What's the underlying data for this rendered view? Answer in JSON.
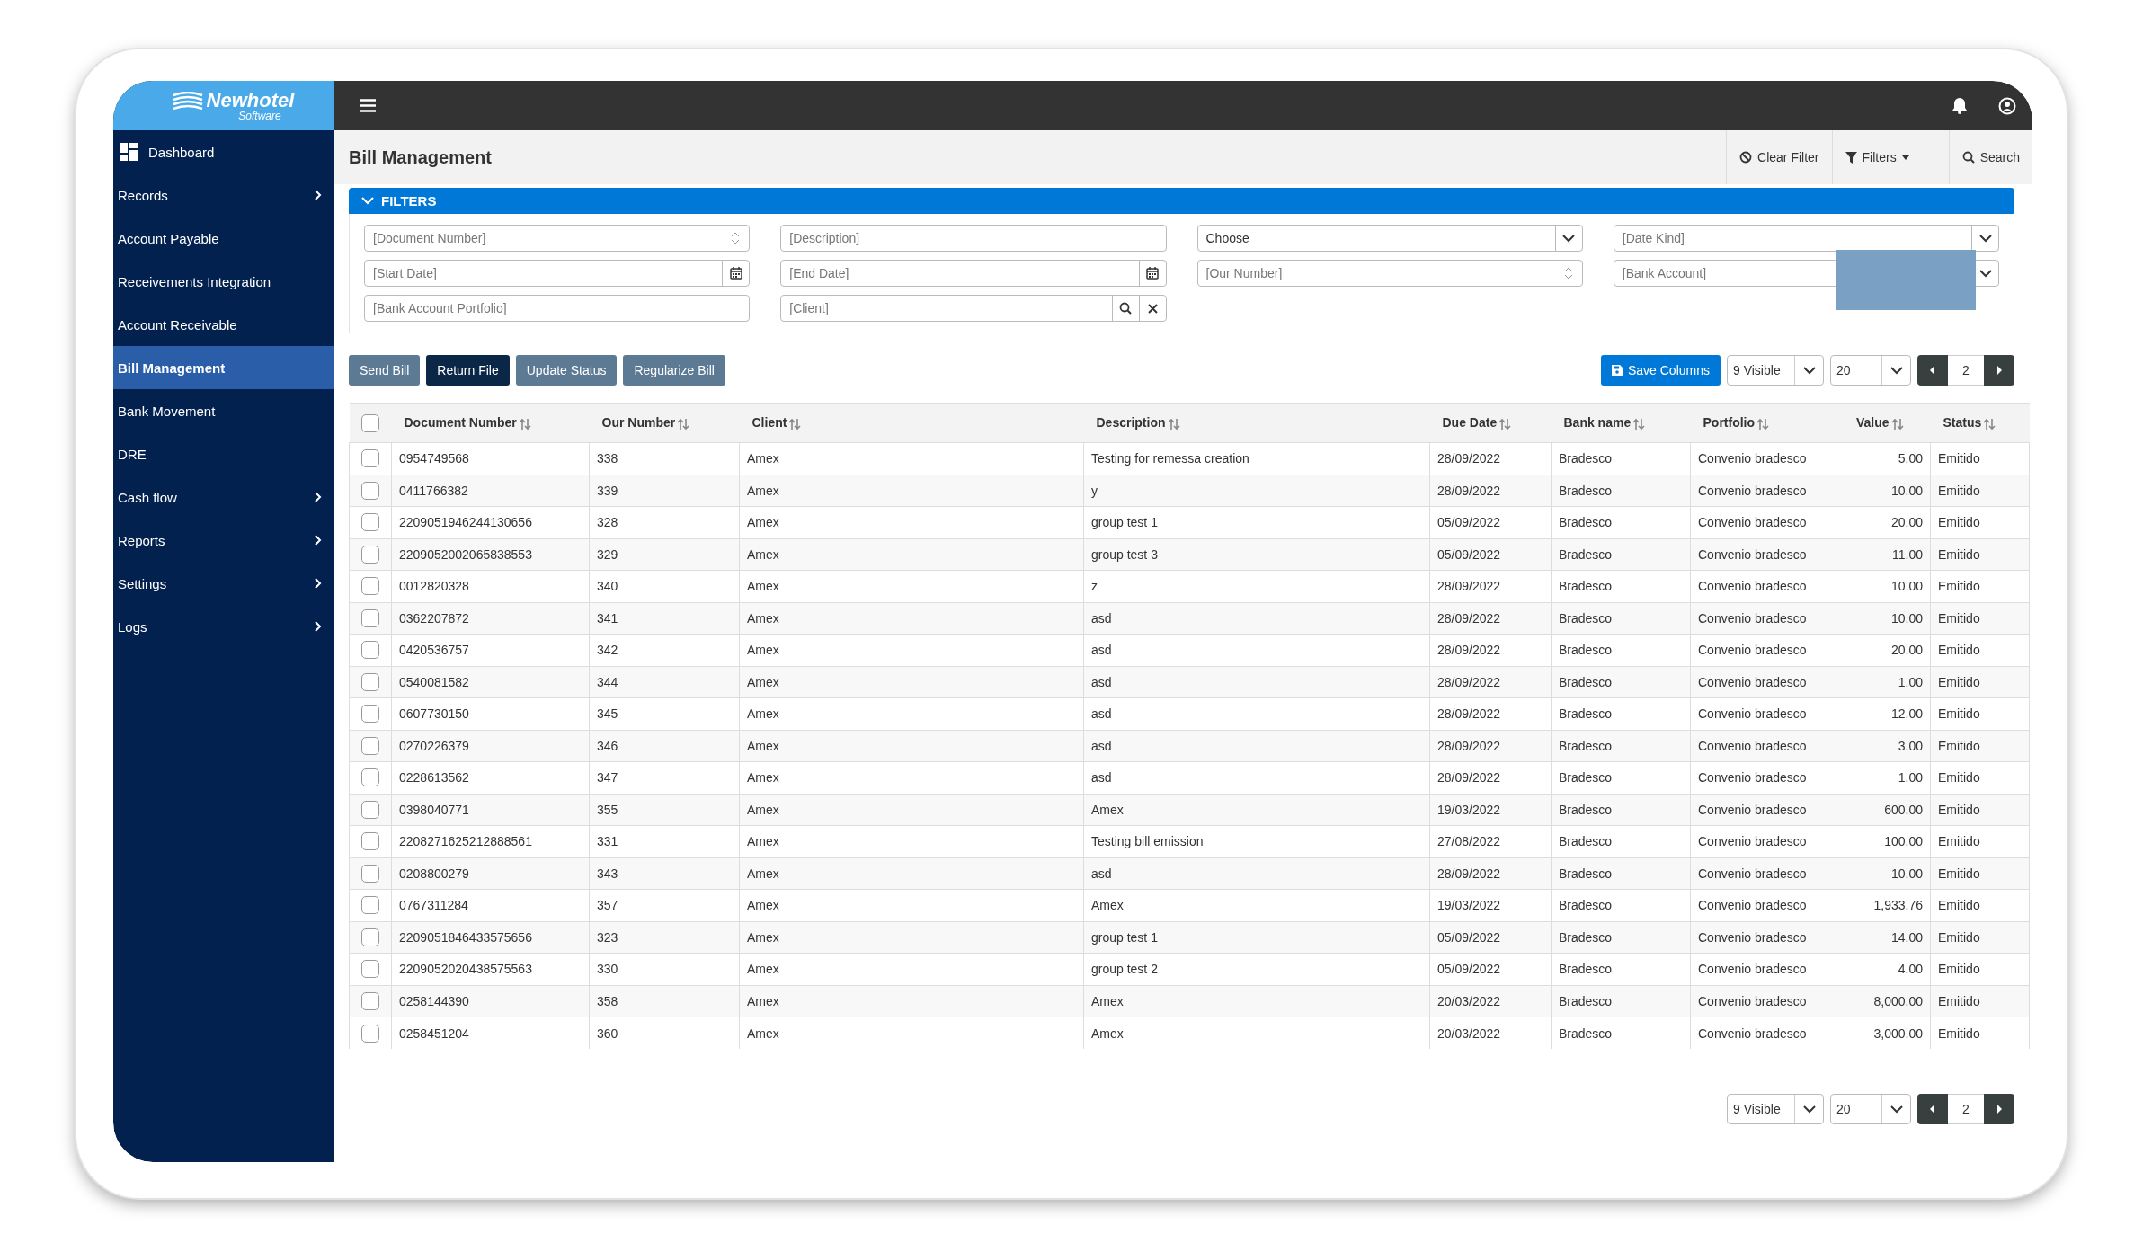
{
  "logo": {
    "name": "Newhotel",
    "tagline": "Software"
  },
  "sidebar": {
    "items": [
      {
        "label": "Dashboard",
        "kind": "home",
        "selected": false
      },
      {
        "label": "Records",
        "kind": "menu",
        "selected": false
      },
      {
        "label": "Account Payable",
        "kind": "link",
        "selected": false
      },
      {
        "label": "Receivements Integration",
        "kind": "link",
        "selected": false
      },
      {
        "label": "Account Receivable",
        "kind": "link",
        "selected": false
      },
      {
        "label": "Bill Management",
        "kind": "link",
        "selected": true
      },
      {
        "label": "Bank Movement",
        "kind": "link",
        "selected": false
      },
      {
        "label": "DRE",
        "kind": "link",
        "selected": false
      },
      {
        "label": "Cash flow",
        "kind": "menu",
        "selected": false
      },
      {
        "label": "Reports",
        "kind": "menu",
        "selected": false
      },
      {
        "label": "Settings",
        "kind": "menu",
        "selected": false
      },
      {
        "label": "Logs",
        "kind": "menu",
        "selected": false
      }
    ]
  },
  "header": {
    "title": "Bill Management",
    "actions": [
      {
        "kind": "clear",
        "label": "Clear Filter"
      },
      {
        "kind": "filters",
        "label": "Filters"
      },
      {
        "kind": "search",
        "label": "Search"
      }
    ]
  },
  "filters": {
    "title": "FILTERS",
    "expanded": true,
    "fields": [
      {
        "kind": "number",
        "placeholder": "[Document Number]"
      },
      {
        "kind": "text",
        "placeholder": "[Description]"
      },
      {
        "kind": "select",
        "value": "Choose"
      },
      {
        "kind": "select",
        "placeholder": "[Date Kind]"
      },
      {
        "kind": "date",
        "placeholder": "[Start Date]"
      },
      {
        "kind": "date",
        "placeholder": "[End Date]"
      },
      {
        "kind": "number",
        "placeholder": "[Our Number]"
      },
      {
        "kind": "select",
        "placeholder": "[Bank Account]"
      },
      {
        "kind": "text",
        "placeholder": "[Bank Account Portfolio]"
      },
      {
        "kind": "lookup",
        "placeholder": "[Client]"
      }
    ]
  },
  "actions": [
    {
      "label": "Send Bill",
      "kind": "secondary"
    },
    {
      "label": "Return File",
      "kind": "primary"
    },
    {
      "label": "Update Status",
      "kind": "secondary"
    },
    {
      "label": "Regularize Bill",
      "kind": "secondary"
    }
  ],
  "save_columns": "Save Columns",
  "top_pager": {
    "visible": "9 Visible",
    "page_size": "20",
    "page": "2"
  },
  "table": {
    "all_selected": false,
    "columns": [
      {
        "label": "Document Number",
        "kind": "text"
      },
      {
        "label": "Our Number",
        "kind": "text"
      },
      {
        "label": "Client",
        "kind": "text"
      },
      {
        "label": "Description",
        "kind": "text"
      },
      {
        "label": "Due Date",
        "kind": "text"
      },
      {
        "label": "Bank name",
        "kind": "text"
      },
      {
        "label": "Portfolio",
        "kind": "text"
      },
      {
        "label": "Value",
        "kind": "amount"
      },
      {
        "label": "Status",
        "kind": "text"
      }
    ],
    "rows": [
      {
        "selected": false,
        "cells": [
          "0954749568",
          "338",
          "Amex",
          "Testing for remessa creation",
          "28/09/2022",
          "Bradesco",
          "Convenio bradesco",
          "5.00",
          "Emitido"
        ]
      },
      {
        "selected": false,
        "cells": [
          "0411766382",
          "339",
          "Amex",
          "y",
          "28/09/2022",
          "Bradesco",
          "Convenio bradesco",
          "10.00",
          "Emitido"
        ]
      },
      {
        "selected": false,
        "cells": [
          "2209051946244130656",
          "328",
          "Amex",
          "group test 1",
          "05/09/2022",
          "Bradesco",
          "Convenio bradesco",
          "20.00",
          "Emitido"
        ]
      },
      {
        "selected": false,
        "cells": [
          "2209052002065838553",
          "329",
          "Amex",
          "group test 3",
          "05/09/2022",
          "Bradesco",
          "Convenio bradesco",
          "11.00",
          "Emitido"
        ]
      },
      {
        "selected": false,
        "cells": [
          "0012820328",
          "340",
          "Amex",
          "z",
          "28/09/2022",
          "Bradesco",
          "Convenio bradesco",
          "10.00",
          "Emitido"
        ]
      },
      {
        "selected": false,
        "cells": [
          "0362207872",
          "341",
          "Amex",
          "asd",
          "28/09/2022",
          "Bradesco",
          "Convenio bradesco",
          "10.00",
          "Emitido"
        ]
      },
      {
        "selected": false,
        "cells": [
          "0420536757",
          "342",
          "Amex",
          "asd",
          "28/09/2022",
          "Bradesco",
          "Convenio bradesco",
          "20.00",
          "Emitido"
        ]
      },
      {
        "selected": false,
        "cells": [
          "0540081582",
          "344",
          "Amex",
          "asd",
          "28/09/2022",
          "Bradesco",
          "Convenio bradesco",
          "1.00",
          "Emitido"
        ]
      },
      {
        "selected": false,
        "cells": [
          "0607730150",
          "345",
          "Amex",
          "asd",
          "28/09/2022",
          "Bradesco",
          "Convenio bradesco",
          "12.00",
          "Emitido"
        ]
      },
      {
        "selected": false,
        "cells": [
          "0270226379",
          "346",
          "Amex",
          "asd",
          "28/09/2022",
          "Bradesco",
          "Convenio bradesco",
          "3.00",
          "Emitido"
        ]
      },
      {
        "selected": false,
        "cells": [
          "0228613562",
          "347",
          "Amex",
          "asd",
          "28/09/2022",
          "Bradesco",
          "Convenio bradesco",
          "1.00",
          "Emitido"
        ]
      },
      {
        "selected": false,
        "cells": [
          "0398040771",
          "355",
          "Amex",
          "Amex",
          "19/03/2022",
          "Bradesco",
          "Convenio bradesco",
          "600.00",
          "Emitido"
        ]
      },
      {
        "selected": false,
        "cells": [
          "2208271625212888561",
          "331",
          "Amex",
          "Testing bill emission",
          "27/08/2022",
          "Bradesco",
          "Convenio bradesco",
          "100.00",
          "Emitido"
        ]
      },
      {
        "selected": false,
        "cells": [
          "0208800279",
          "343",
          "Amex",
          "asd",
          "28/09/2022",
          "Bradesco",
          "Convenio bradesco",
          "10.00",
          "Emitido"
        ]
      },
      {
        "selected": false,
        "cells": [
          "0767311284",
          "357",
          "Amex",
          "Amex",
          "19/03/2022",
          "Bradesco",
          "Convenio bradesco",
          "1,933.76",
          "Emitido"
        ]
      },
      {
        "selected": false,
        "cells": [
          "2209051846433575656",
          "323",
          "Amex",
          "group test 1",
          "05/09/2022",
          "Bradesco",
          "Convenio bradesco",
          "14.00",
          "Emitido"
        ]
      },
      {
        "selected": false,
        "cells": [
          "2209052020438575563",
          "330",
          "Amex",
          "group test 2",
          "05/09/2022",
          "Bradesco",
          "Convenio bradesco",
          "4.00",
          "Emitido"
        ]
      },
      {
        "selected": false,
        "cells": [
          "0258144390",
          "358",
          "Amex",
          "Amex",
          "20/03/2022",
          "Bradesco",
          "Convenio bradesco",
          "8,000.00",
          "Emitido"
        ]
      },
      {
        "selected": false,
        "cells": [
          "0258451204",
          "360",
          "Amex",
          "Amex",
          "20/03/2022",
          "Bradesco",
          "Convenio bradesco",
          "3,000.00",
          "Emitido"
        ]
      }
    ]
  },
  "bottom_pager": {
    "visible": "9 Visible",
    "page_size": "20",
    "page": "2"
  }
}
